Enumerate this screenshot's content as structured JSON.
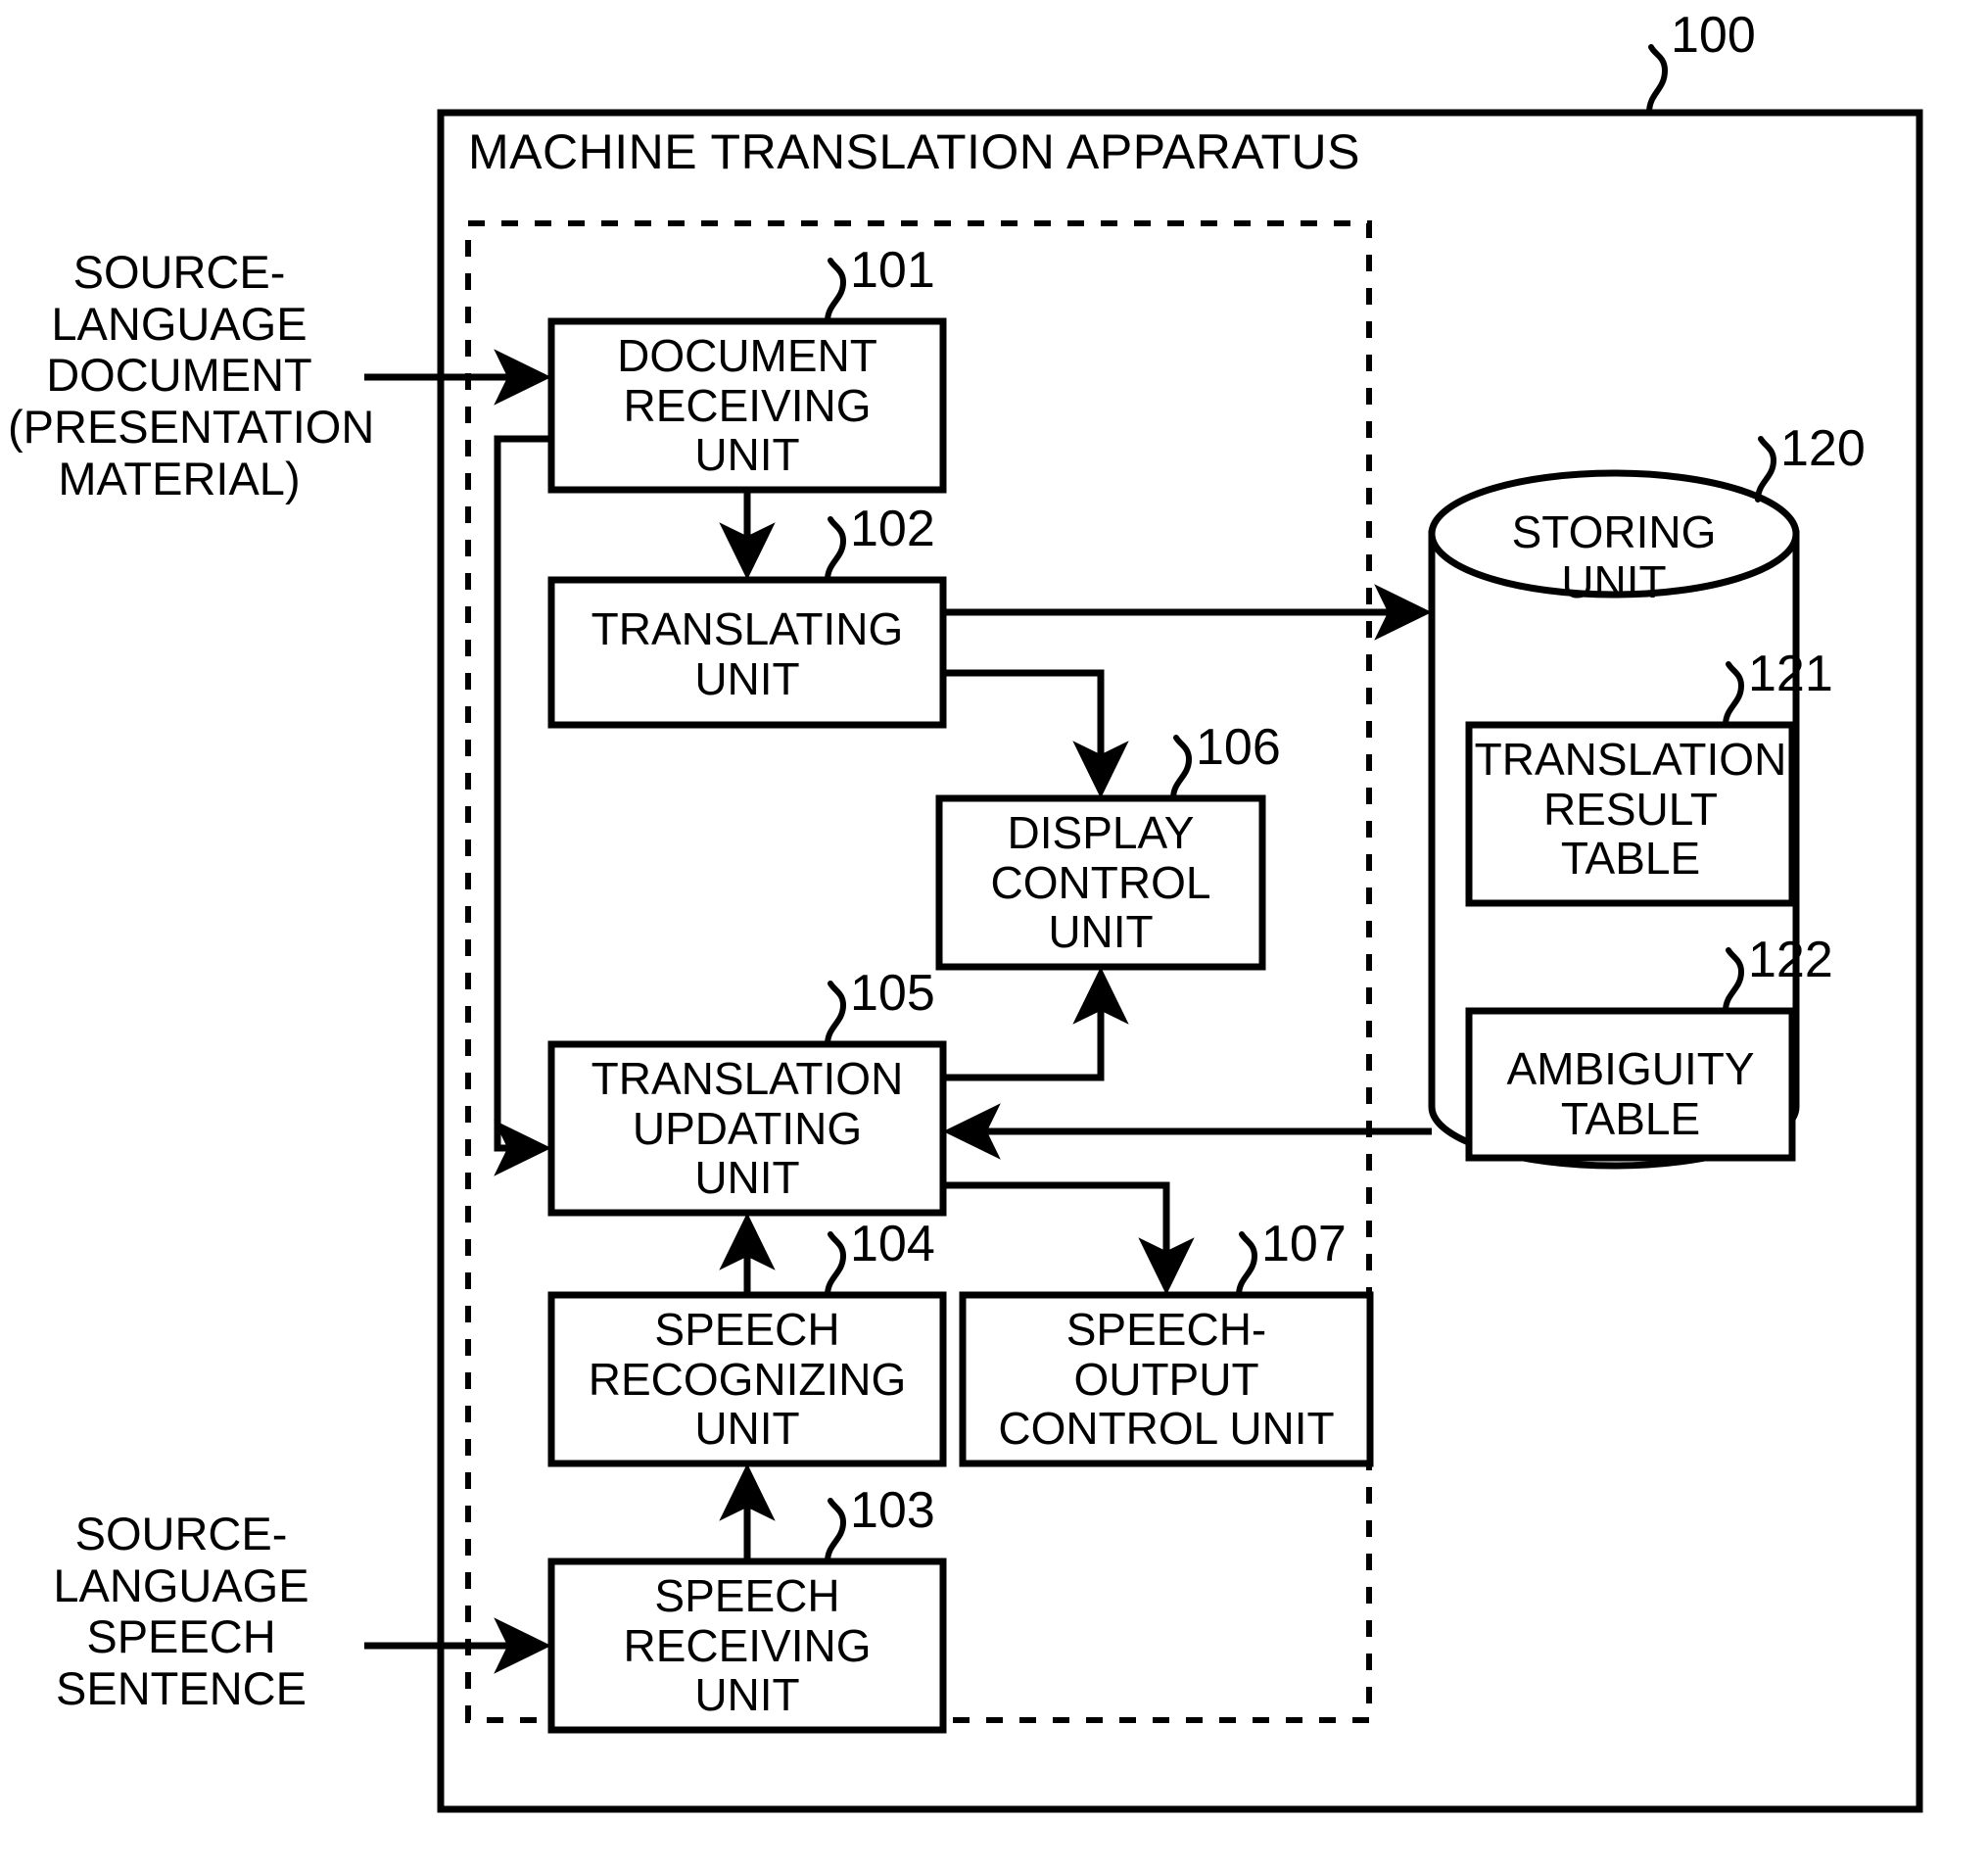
{
  "figure": {
    "title": "MACHINE TRANSLATION APPARATUS",
    "apparatus_numeral": "100"
  },
  "external_inputs": [
    {
      "name": "source-language-document",
      "text": "SOURCE-\nLANGUAGE\nDOCUMENT\n(PRESENTATION\nMATERIAL)"
    },
    {
      "name": "source-language-speech",
      "text": "SOURCE-\nLANGUAGE\nSPEECH\nSENTENCE"
    }
  ],
  "blocks": {
    "b101": {
      "label": "DOCUMENT\nRECEIVING\nUNIT",
      "numeral": "101"
    },
    "b102": {
      "label": "TRANSLATING\nUNIT",
      "numeral": "102"
    },
    "b103": {
      "label": "SPEECH\nRECEIVING\nUNIT",
      "numeral": "103"
    },
    "b104": {
      "label": "SPEECH\nRECOGNIZING\nUNIT",
      "numeral": "104"
    },
    "b105": {
      "label": "TRANSLATION\nUPDATING\nUNIT",
      "numeral": "105"
    },
    "b106": {
      "label": "DISPLAY\nCONTROL\nUNIT",
      "numeral": "106"
    },
    "b107": {
      "label": "SPEECH-\nOUTPUT\nCONTROL UNIT",
      "numeral": "107"
    }
  },
  "storage": {
    "unit": {
      "label": "STORING\nUNIT",
      "numeral": "120"
    },
    "tables": [
      {
        "label": "TRANSLATION\nRESULT\nTABLE",
        "numeral": "121"
      },
      {
        "label": "AMBIGUITY\nTABLE",
        "numeral": "122"
      }
    ]
  },
  "colors": {
    "ink": "#000000",
    "paper": "#ffffff"
  }
}
